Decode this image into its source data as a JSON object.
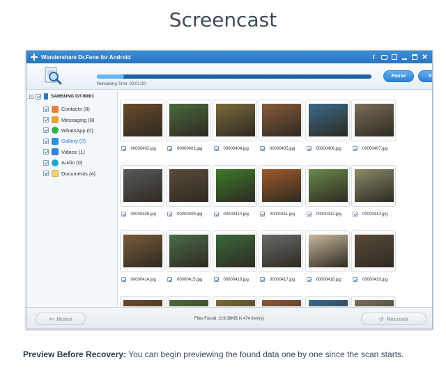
{
  "page": {
    "title": "Screencast",
    "caption_bold": "Preview Before Recovery:",
    "caption_text": " You can begin previewing the found data one by one since the scan starts."
  },
  "window": {
    "title": "Wondershare Dr.Fone for Android",
    "controls": [
      "facebook-icon",
      "chat-icon",
      "feedback-icon",
      "minimize-icon",
      "maximize-icon",
      "close-icon"
    ]
  },
  "toolbar": {
    "remaining_time": "Remaining Time: 02:01:30",
    "progress": 0.1,
    "pause_label": "Pause",
    "stop_label": "Stop"
  },
  "sidebar": {
    "device": "SAMSUNG GT-I9001",
    "items": [
      {
        "label": "Contacts (8)",
        "icon": "contacts-icon"
      },
      {
        "label": "Messaging (8)",
        "icon": "messaging-icon"
      },
      {
        "label": "WhatsApp (0)",
        "icon": "whatsapp-icon"
      },
      {
        "label": "Gallery (2)",
        "icon": "gallery-icon",
        "selected": true
      },
      {
        "label": "Videos (1)",
        "icon": "videos-icon"
      },
      {
        "label": "Audio (0)",
        "icon": "audio-icon"
      },
      {
        "label": "Documents (4)",
        "icon": "documents-icon"
      }
    ]
  },
  "gallery": {
    "files": [
      "00000402.jpg",
      "00000403.jpg",
      "00000404.jpg",
      "00000405.jpg",
      "00000406.jpg",
      "00000407.jpg",
      "00000408.jpg",
      "00000409.jpg",
      "00000410.jpg",
      "00000411.jpg",
      "00000412.jpg",
      "00000413.jpg",
      "00000414.jpg",
      "00000415.jpg",
      "00000416.jpg",
      "00000417.jpg",
      "00000418.jpg",
      "00000419.jpg"
    ],
    "partial_row_count": 6,
    "colors": [
      "#6b4a2a",
      "#4a6a3c",
      "#7b6a3a",
      "#8a5a3a",
      "#3a6a8a",
      "#7b6e5a",
      "#5a5a5a",
      "#5a4a3a",
      "#3d7a2a",
      "#a05a2a",
      "#6a8a4a",
      "#8a8a6a",
      "#7a5a3a",
      "#4a6a4a",
      "#3a6a3a",
      "#6a6a6a",
      "#c8b89a",
      "#5a4a3a"
    ]
  },
  "status": {
    "home_label": "Home",
    "files_found": "Files Found: 219.38MB in 474 item(s)",
    "recover_label": "Recover"
  }
}
